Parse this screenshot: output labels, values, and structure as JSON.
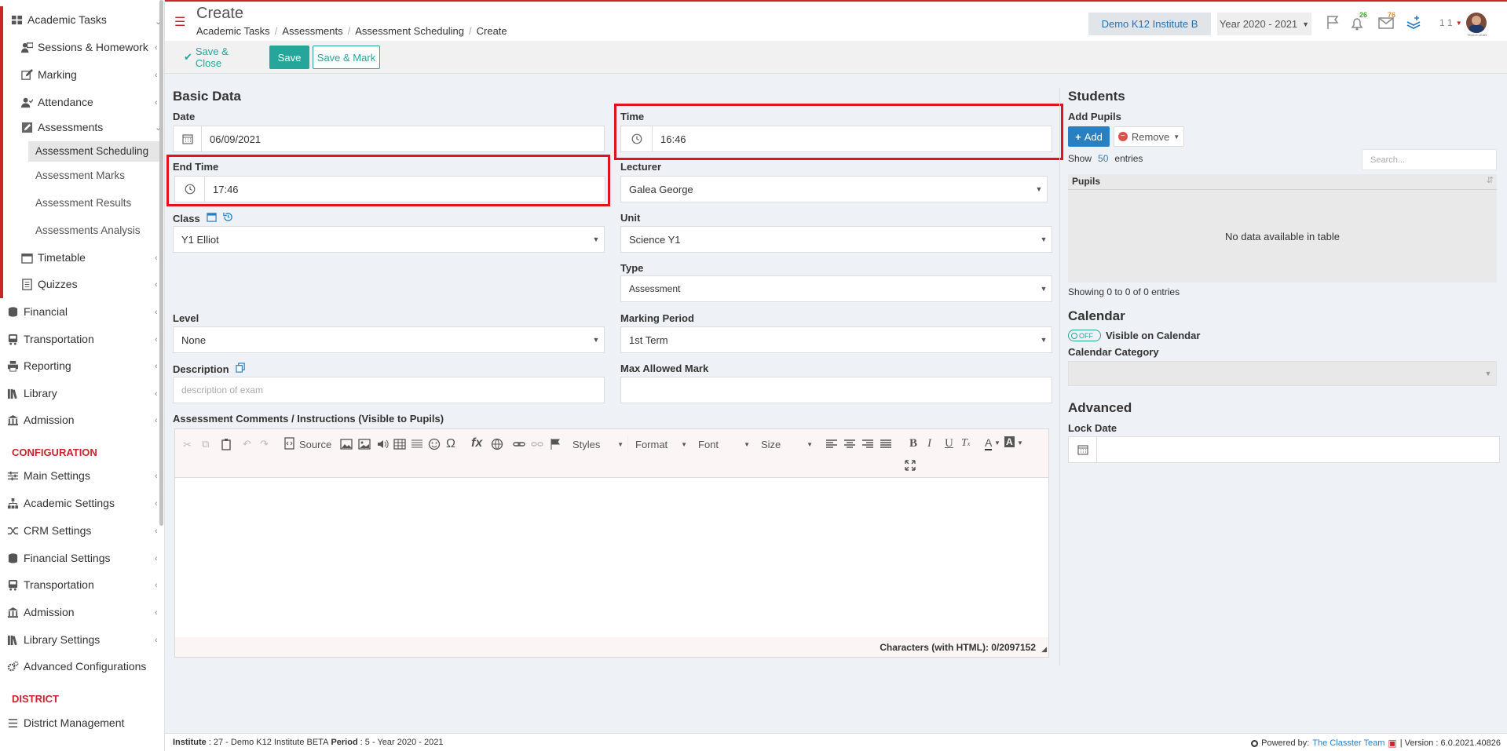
{
  "sidebar": {
    "items": [
      {
        "label": "Academic Tasks",
        "icon": "grid-icon"
      },
      {
        "label": "Sessions & Homework",
        "icon": "teacher-icon"
      },
      {
        "label": "Marking",
        "icon": "edit-icon"
      },
      {
        "label": "Attendance",
        "icon": "user-check-icon"
      },
      {
        "label": "Assessments",
        "icon": "pencil-square-icon"
      },
      {
        "label": "Assessment Scheduling"
      },
      {
        "label": "Assessment Marks"
      },
      {
        "label": "Assessment Results"
      },
      {
        "label": "Assessments Analysis"
      },
      {
        "label": "Timetable",
        "icon": "calendar-icon"
      },
      {
        "label": "Quizzes",
        "icon": "quiz-icon"
      },
      {
        "label": "Financial",
        "icon": "coins-icon"
      },
      {
        "label": "Transportation",
        "icon": "bus-icon"
      },
      {
        "label": "Reporting",
        "icon": "printer-icon"
      },
      {
        "label": "Library",
        "icon": "books-icon"
      },
      {
        "label": "Admission",
        "icon": "building-icon"
      }
    ],
    "config_heading": "CONFIGURATION",
    "config_items": [
      {
        "label": "Main Settings",
        "icon": "sliders-icon"
      },
      {
        "label": "Academic Settings",
        "icon": "sitemap-icon"
      },
      {
        "label": "CRM Settings",
        "icon": "shuffle-icon"
      },
      {
        "label": "Financial Settings",
        "icon": "coins-icon"
      },
      {
        "label": "Transportation",
        "icon": "bus-icon"
      },
      {
        "label": "Admission",
        "icon": "building-icon"
      },
      {
        "label": "Library Settings",
        "icon": "books-icon"
      },
      {
        "label": "Advanced Configurations",
        "icon": "gears-icon"
      }
    ],
    "district_heading": "DISTRICT",
    "district_items": [
      {
        "label": "District Management",
        "icon": "list-icon"
      }
    ]
  },
  "header": {
    "title": "Create",
    "breadcrumbs": [
      "Academic Tasks",
      "Assessments",
      "Assessment Scheduling",
      "Create"
    ],
    "institute": "Demo K12 Institute B",
    "year": "Year 2020 - 2021",
    "notifications_count": "26",
    "messages_count": "76",
    "user_label": "1 1",
    "avatar_caption": "TEACH LEAD"
  },
  "actions": {
    "save_close": "Save & Close",
    "save": "Save",
    "save_mark": "Save & Mark"
  },
  "form": {
    "heading": "Basic Data",
    "date_label": "Date",
    "date_value": "06/09/2021",
    "time_label": "Time",
    "time_value": "16:46",
    "end_time_label": "End Time",
    "end_time_value": "17:46",
    "lecturer_label": "Lecturer",
    "lecturer_value": "Galea George",
    "class_label": "Class",
    "class_value": "Y1 Elliot",
    "unit_label": "Unit",
    "unit_value": "Science Y1",
    "type_label": "Type",
    "type_value": "Assessment",
    "level_label": "Level",
    "level_value": "None",
    "marking_period_label": "Marking Period",
    "marking_period_value": "1st Term",
    "description_label": "Description",
    "description_placeholder": "description of exam",
    "max_mark_label": "Max Allowed Mark",
    "max_mark_value": "",
    "comments_label": "Assessment Comments / Instructions (Visible to Pupils)"
  },
  "editor": {
    "source_label": "Source",
    "styles_label": "Styles",
    "format_label": "Format",
    "font_label": "Font",
    "size_label": "Size",
    "char_count": "Characters (with HTML): 0/2097152"
  },
  "students": {
    "heading": "Students",
    "add_pupils_label": "Add Pupils",
    "add_button": "Add",
    "remove_button": "Remove",
    "show_label": "Show",
    "entries_value": "50",
    "entries_label": "entries",
    "search_placeholder": "Search...",
    "column_pupils": "Pupils",
    "empty_message": "No data available in table",
    "showing_text": "Showing 0 to 0 of 0 entries"
  },
  "calendar": {
    "heading": "Calendar",
    "toggle_state": "OFF",
    "visible_label": "Visible on Calendar",
    "category_label": "Calendar Category"
  },
  "advanced": {
    "heading": "Advanced",
    "lock_date_label": "Lock Date"
  },
  "footer": {
    "institute_label": "Institute",
    "institute_value": ": 27 - Demo K12 Institute BETA",
    "period_label": "Period",
    "period_value": ": 5 - Year 2020 - 2021",
    "powered_label": "Powered by:",
    "powered_link": "The Classter Team",
    "version": "| Version : 6.0.2021.40826"
  },
  "colors": {
    "brand_red": "#c9242c",
    "save_green": "#26a69a",
    "add_blue": "#2a7fc1",
    "link_blue": "#2a7fc1"
  }
}
